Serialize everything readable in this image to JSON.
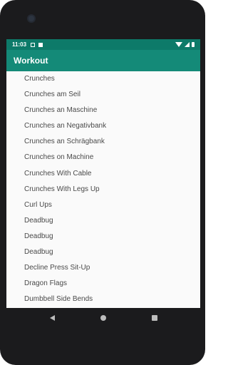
{
  "status_bar": {
    "time": "11:03"
  },
  "app_bar": {
    "title": "Workout"
  },
  "exercises": [
    "Crunches",
    "Crunches am Seil",
    "Crunches an Maschine",
    "Crunches an Negativbank",
    "Crunches an Schrägbank",
    "Crunches on Machine",
    "Crunches With Cable",
    "Crunches With Legs Up",
    "Curl Ups",
    "Deadbug",
    "Deadbug",
    "Deadbug",
    "Decline Press Sit-Up",
    "Dragon Flags",
    "Dumbbell Side Bends"
  ],
  "colors": {
    "status_bar": "#0d7a69",
    "app_bar": "#148a78",
    "list_text": "#4a4a4a"
  },
  "nav_icons": [
    "back-icon",
    "home-icon",
    "recents-icon"
  ]
}
